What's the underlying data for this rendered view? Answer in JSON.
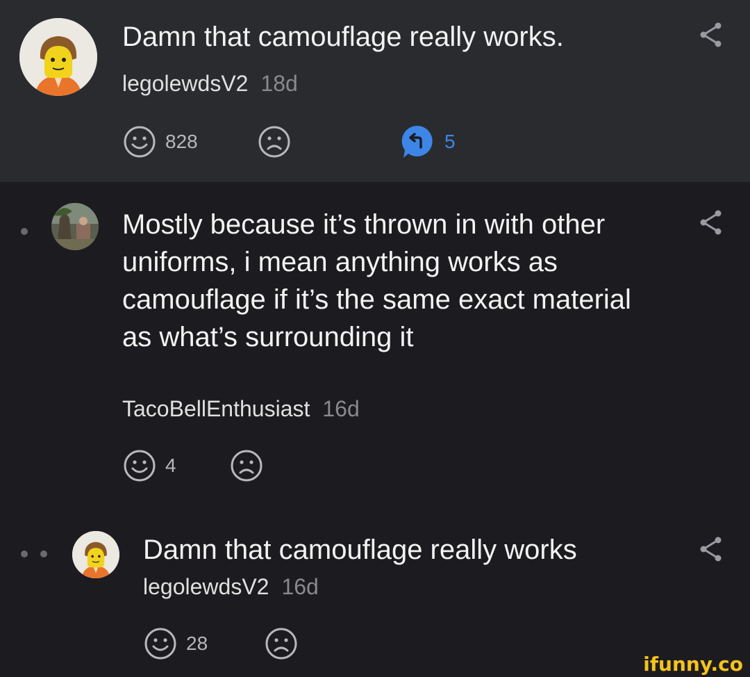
{
  "comments": [
    {
      "text": "Damn that camouflage really works.",
      "author": "legolewdsV2",
      "age": "18d",
      "likes": "828",
      "replies": "5"
    },
    {
      "text": "Mostly because it’s thrown in with other uniforms, i mean anything works as camouflage if it’s the same exact material as what’s surrounding it",
      "author": "TacoBellEnthusiast",
      "age": "16d",
      "likes": "4"
    },
    {
      "text": "Damn that camouflage really works",
      "author": "legolewdsV2",
      "age": "16d",
      "likes": "28"
    }
  ],
  "icons": {
    "like": "smile-icon",
    "dislike": "frown-icon",
    "reply": "reply-icon",
    "share": "share-icon"
  },
  "colors": {
    "top_comment_bg": "#2a2b2f",
    "page_bg": "#1c1c20",
    "reply_accent": "#3d86e8",
    "watermark": "#f6c21c"
  },
  "watermark": "ifunny.co"
}
